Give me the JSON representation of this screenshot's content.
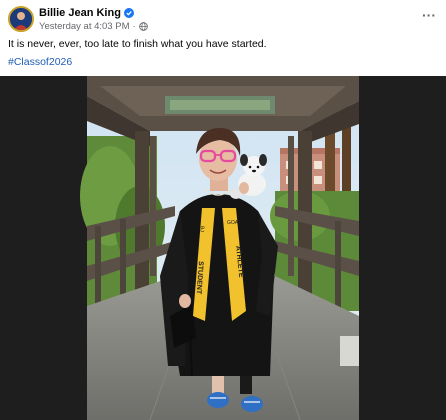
{
  "post": {
    "author_name": "Billie Jean King",
    "timestamp": "Yesterday at 4:03 PM",
    "separator": "·",
    "caption": "It is never, ever, too late to finish what you have started.",
    "hashtag": "#Classof2026",
    "more_label": "···"
  },
  "icons": {
    "avatar": "avatar-image",
    "verified": "verified-badge-icon",
    "audience": "globe-icon",
    "more": "more-options-icon"
  },
  "photo": {
    "stole_left_text": "STUDENT",
    "stole_right_text": "ATHLETE",
    "stole_left_small": "BJ",
    "stole_right_small": "GOAT"
  },
  "colors": {
    "link": "#1f5db3",
    "verified": "#1877f2",
    "stole": "#f2c12e",
    "gown": "#141414"
  }
}
